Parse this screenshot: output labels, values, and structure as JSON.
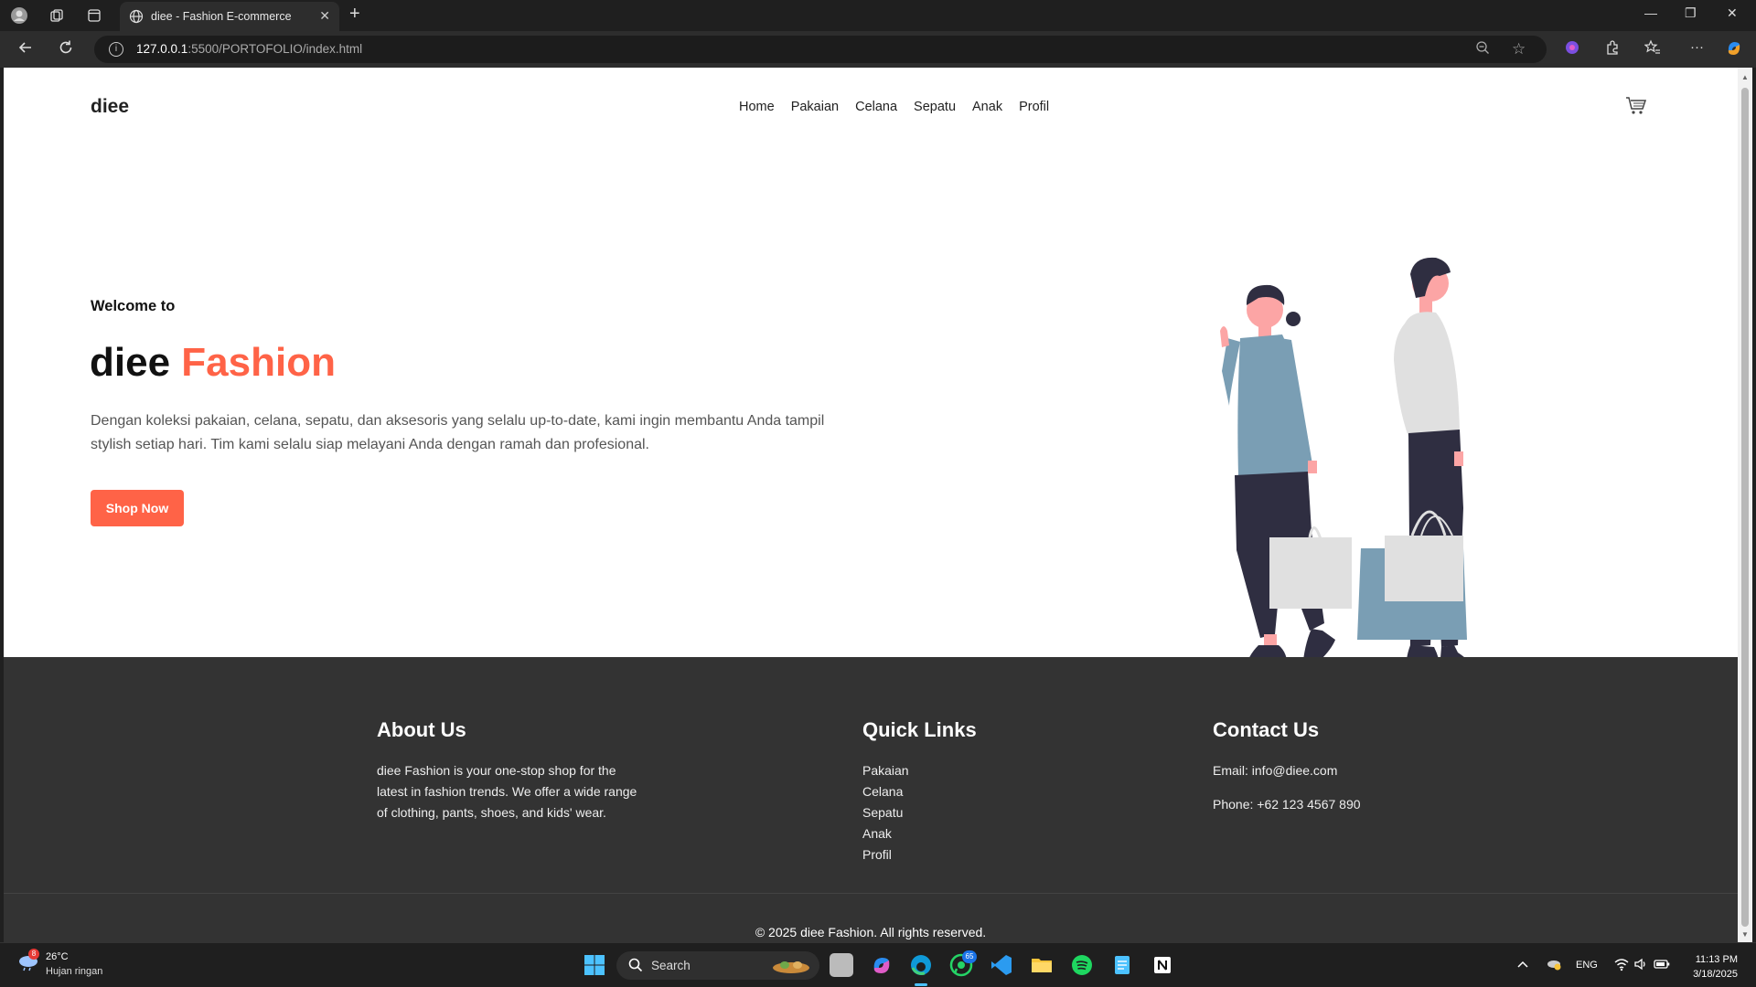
{
  "browser": {
    "tab_title": "diee - Fashion E-commerce",
    "url_host": "127.0.0.1",
    "url_path": ":5500/PORTOFOLIO/index.html"
  },
  "site": {
    "logo": "diee",
    "nav": [
      "Home",
      "Pakaian",
      "Celana",
      "Sepatu",
      "Anak",
      "Profil"
    ],
    "cart_icon": "cart-icon"
  },
  "hero": {
    "welcome": "Welcome to",
    "title_main": "diee",
    "title_accent": "Fashion",
    "description": "Dengan koleksi pakaian, celana, sepatu, dan aksesoris yang selalu up-to-date, kami ingin membantu Anda tampil stylish setiap hari. Tim kami selalu siap melayani Anda dengan ramah dan profesional.",
    "button": "Shop Now",
    "accent_color": "#ff6347"
  },
  "footer": {
    "about_title": "About Us",
    "about_text": "diee Fashion is your one-stop shop for the latest in fashion trends. We offer a wide range of clothing, pants, shoes, and kids' wear.",
    "links_title": "Quick Links",
    "links": [
      "Pakaian",
      "Celana",
      "Sepatu",
      "Anak",
      "Profil"
    ],
    "contact_title": "Contact Us",
    "email": "Email: info@diee.com",
    "phone": "Phone: +62 123 4567 890",
    "copyright": "© 2025 diee Fashion. All rights reserved."
  },
  "taskbar": {
    "temp": "26°C",
    "condition": "Hujan ringan",
    "weather_badge": "8",
    "search_placeholder": "Search",
    "whatsapp_badge": "65",
    "language": "ENG",
    "time": "11:13 PM",
    "date": "3/18/2025"
  }
}
